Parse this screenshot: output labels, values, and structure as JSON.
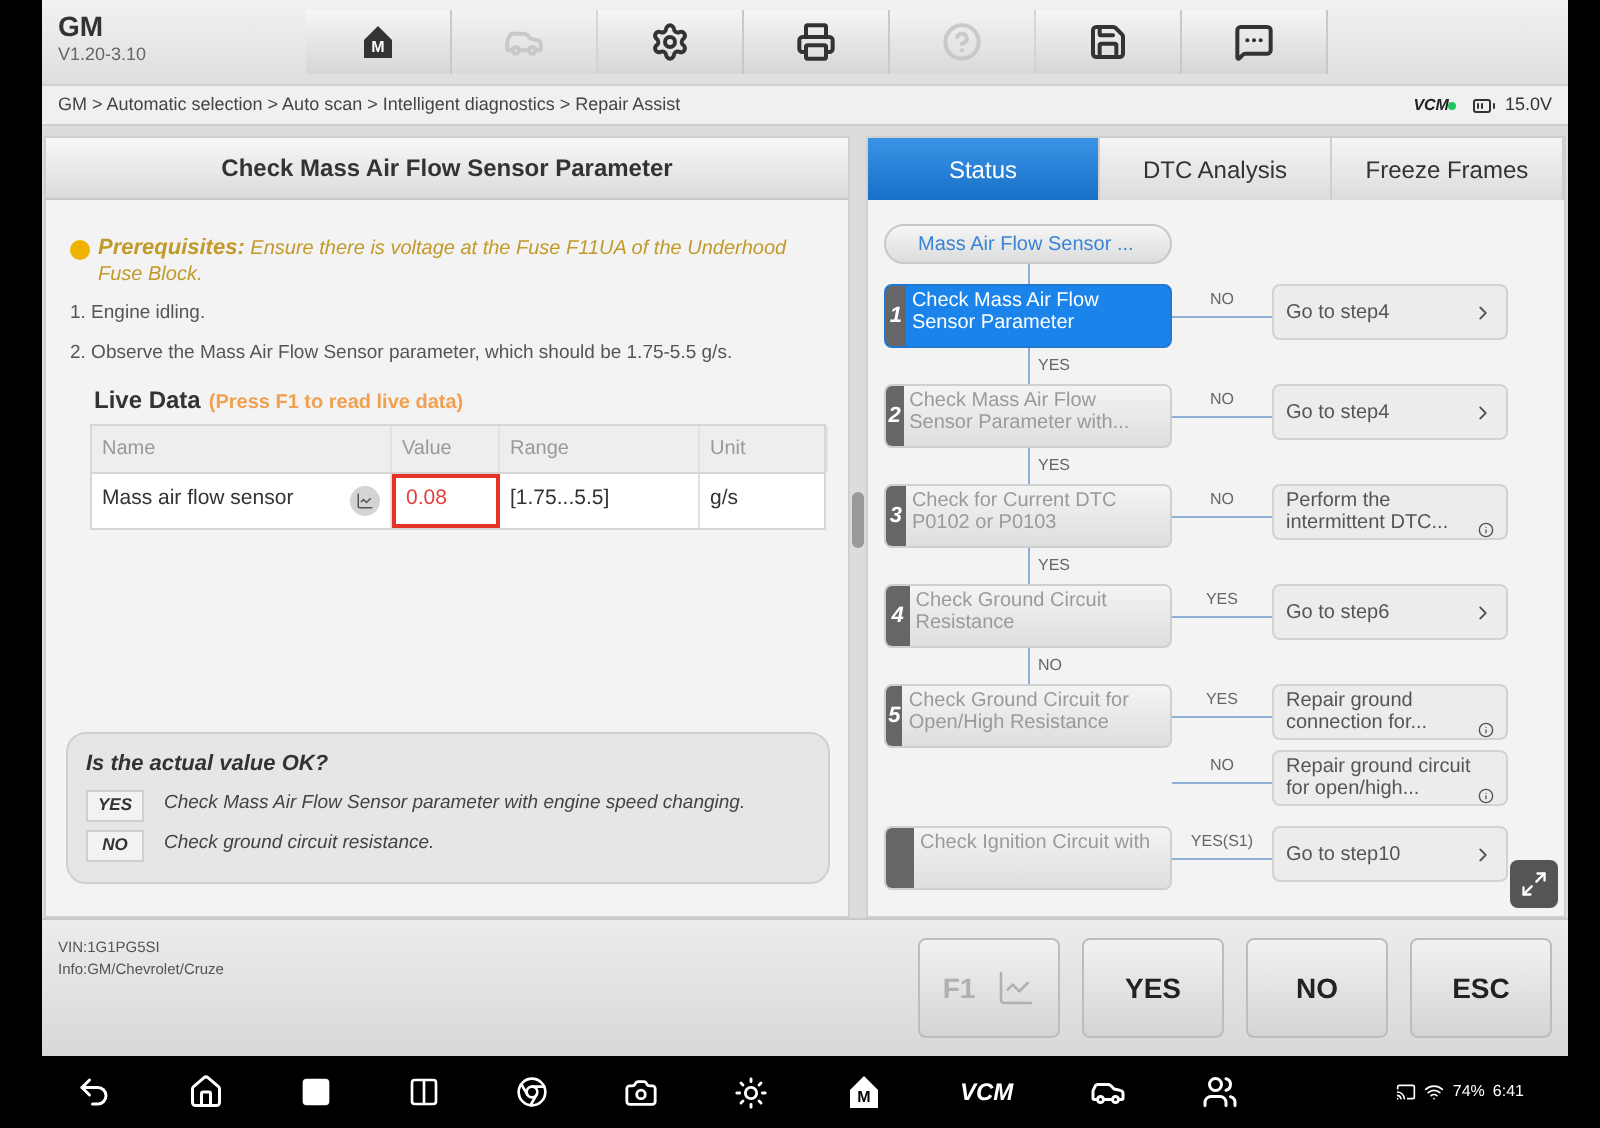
{
  "app": {
    "title": "GM",
    "version": "V1.20-3.10"
  },
  "toolbar": [
    {
      "badge": "M",
      "disabled": false
    },
    {
      "disabled": true
    },
    {
      "disabled": false
    },
    {
      "disabled": false
    },
    {
      "disabled": true
    },
    {
      "disabled": false
    },
    {
      "disabled": false
    }
  ],
  "breadcrumb": "GM > Automatic selection > Auto scan > Intelligent diagnostics > Repair Assist",
  "vci": {
    "label": "VCM",
    "connected": true
  },
  "voltage": "15.0V",
  "procedure": {
    "title": "Check Mass Air Flow Sensor Parameter",
    "prereq_label": "Prerequisites:",
    "prereq_text": "Ensure there is voltage at the Fuse F11UA of the Underhood Fuse Block.",
    "steps": [
      "1. Engine idling.",
      "2. Observe the Mass Air Flow Sensor parameter, which should be 1.75-5.5 g/s."
    ],
    "live_data_title": "Live Data",
    "live_data_hint": "(Press F1 to read live data)",
    "columns": [
      "Name",
      "Value",
      "Range",
      "Unit"
    ],
    "rows": [
      {
        "name": "Mass air flow sensor",
        "value": "0.08",
        "range": "[1.75...5.5]",
        "unit": "g/s",
        "out_of_range": true
      }
    ],
    "question": "Is the actual value OK?",
    "answers": [
      {
        "key": "YES",
        "text": "Check Mass Air Flow Sensor parameter with engine speed changing."
      },
      {
        "key": "NO",
        "text": "Check ground circuit resistance."
      }
    ]
  },
  "tabs": [
    {
      "label": "Status",
      "selected": true
    },
    {
      "label": "DTC Analysis",
      "selected": false
    },
    {
      "label": "Freeze Frames",
      "selected": false
    }
  ],
  "flow": {
    "start": "Mass Air Flow Sensor ...",
    "steps": [
      {
        "number": "1",
        "title": "Check Mass Air Flow Sensor Parameter",
        "selected": true,
        "next_label": "YES",
        "branches": [
          {
            "label": "NO",
            "target": "Go to step4",
            "kind": "goto"
          }
        ]
      },
      {
        "number": "2",
        "title": "Check Mass Air Flow Sensor Parameter with...",
        "selected": false,
        "next_label": "YES",
        "branches": [
          {
            "label": "NO",
            "target": "Go to step4",
            "kind": "goto"
          }
        ]
      },
      {
        "number": "3",
        "title": "Check for Current DTC P0102 or P0103",
        "selected": false,
        "next_label": "YES",
        "branches": [
          {
            "label": "NO",
            "target": "Perform the intermittent DTC...",
            "kind": "info"
          }
        ]
      },
      {
        "number": "4",
        "title": "Check Ground Circuit Resistance",
        "selected": false,
        "next_label": "NO",
        "branches": [
          {
            "label": "YES",
            "target": "Go to step6",
            "kind": "goto"
          }
        ]
      },
      {
        "number": "5",
        "title": "Check Ground Circuit for Open/High Resistance",
        "selected": false,
        "branches": [
          {
            "label": "YES",
            "target": "Repair ground connection for...",
            "kind": "info"
          },
          {
            "label": "NO",
            "target": "Repair ground circuit for open/high...",
            "kind": "info"
          }
        ]
      },
      {
        "title": "Check Ignition Circuit with",
        "selected": false,
        "branches": [
          {
            "label": "YES(S1)",
            "target": "Go to step10",
            "kind": "goto"
          }
        ]
      }
    ]
  },
  "vehicle": {
    "vin": "VIN:1G1PG5SI",
    "info": "Info:GM/Chevrolet/Cruze"
  },
  "buttons": [
    {
      "label": "F1",
      "kind": "chart",
      "disabled": true
    },
    {
      "label": "YES",
      "disabled": false
    },
    {
      "label": "NO",
      "disabled": false
    },
    {
      "label": "ESC",
      "disabled": false
    }
  ],
  "navbar": {
    "vcm": "VCM",
    "battery": "74%",
    "time": "6:41",
    "home_badge": "M"
  }
}
